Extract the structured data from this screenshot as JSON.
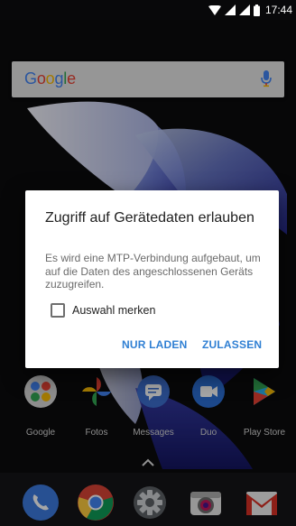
{
  "status_bar": {
    "time": "17:44",
    "icons": [
      "wifi-icon",
      "signal-icon",
      "signal-icon-2",
      "battery-icon"
    ]
  },
  "search_bar": {
    "logo_letters": [
      "G",
      "o",
      "o",
      "g",
      "l",
      "e"
    ],
    "logo_colors": [
      "#4285f4",
      "#ea4335",
      "#fbbc05",
      "#4285f4",
      "#34a853",
      "#ea4335"
    ],
    "mic_icon": "mic-icon"
  },
  "dialog": {
    "title": "Zugriff auf Gerätedaten erlauben",
    "message": "Es wird eine MTP-Verbindung aufgebaut, um auf die Daten des angeschlossenen Geräts zuzugreifen.",
    "checkbox_label": "Auswahl merken",
    "checkbox_checked": false,
    "button_charge": "NUR LADEN",
    "button_allow": "ZULASSEN",
    "accent_color": "#2f7fd3"
  },
  "home_apps": [
    {
      "label": "Google",
      "icon": "google-folder-icon"
    },
    {
      "label": "Fotos",
      "icon": "photos-icon"
    },
    {
      "label": "Messages",
      "icon": "messages-icon"
    },
    {
      "label": "Duo",
      "icon": "duo-icon"
    },
    {
      "label": "Play Store",
      "icon": "play-store-icon"
    }
  ],
  "dock_apps": [
    {
      "name": "Phone",
      "icon": "phone-icon"
    },
    {
      "name": "Chrome",
      "icon": "chrome-icon"
    },
    {
      "name": "Settings",
      "icon": "settings-icon"
    },
    {
      "name": "Camera",
      "icon": "camera-icon"
    },
    {
      "name": "Gmail",
      "icon": "gmail-icon"
    }
  ]
}
